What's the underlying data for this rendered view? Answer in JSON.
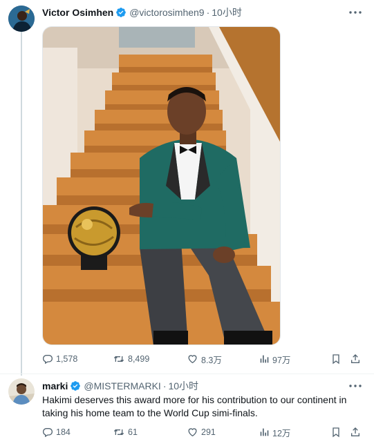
{
  "tweet": {
    "author_name": "Victor Osimhen",
    "handle": "@victorosimhen9",
    "separator": "·",
    "time": "10小时",
    "stats": {
      "replies": "1,578",
      "retweets": "8,499",
      "likes": "8.3万",
      "views": "97万"
    }
  },
  "reply": {
    "author_name": "marki",
    "handle": "@MISTERMARKI",
    "separator": "·",
    "time": "10小时",
    "text": "Hakimi deserves this award more for his contribution to our continent in taking his home team to the World Cup simi-finals.",
    "stats": {
      "replies": "184",
      "retweets": "61",
      "likes": "291",
      "views": "12万"
    }
  },
  "colors": {
    "verified": "#1d9bf0",
    "secondary_text": "#536471",
    "thread_line": "#cfd9de"
  },
  "icons": [
    "verified-badge-icon",
    "more-icon",
    "reply-icon",
    "retweet-icon",
    "like-icon",
    "views-icon",
    "bookmark-icon",
    "share-icon"
  ]
}
